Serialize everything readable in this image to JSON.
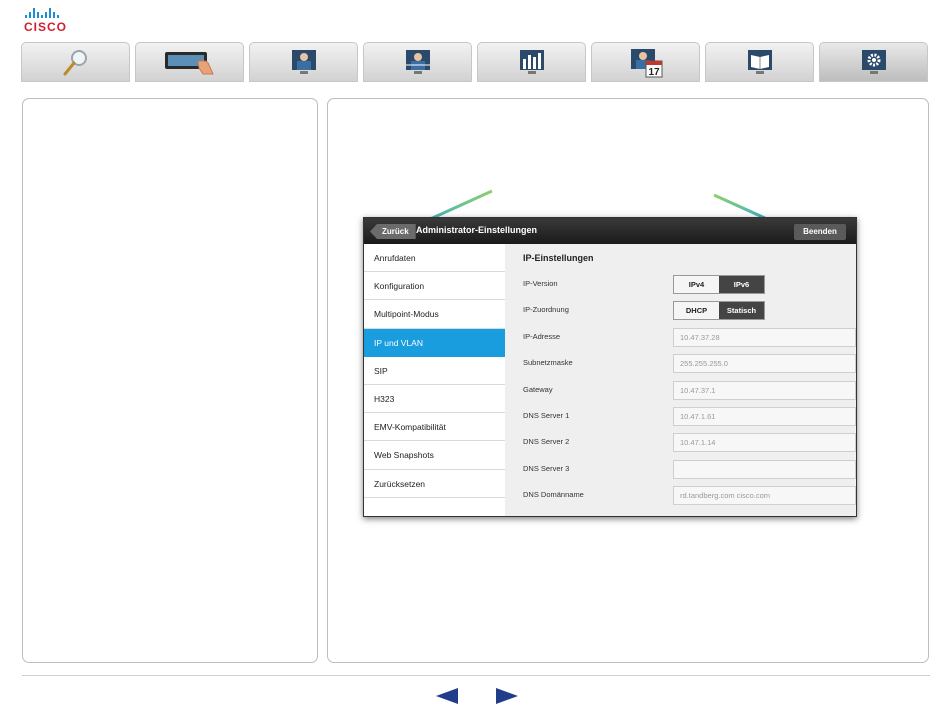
{
  "brand": {
    "name": "CISCO",
    "logo_color": "#d0202f",
    "bars_color": "#1b8fd1"
  },
  "tabs": [
    {
      "icon": "magnifier-icon"
    },
    {
      "icon": "touch-panel-icon"
    },
    {
      "icon": "presenter-icon"
    },
    {
      "icon": "network-presenter-icon"
    },
    {
      "icon": "statistics-presenter-icon"
    },
    {
      "icon": "calendar-presenter-icon",
      "calendar_day": "17"
    },
    {
      "icon": "book-presenter-icon"
    },
    {
      "icon": "settings-presenter-icon",
      "active": true
    }
  ],
  "screenshot": {
    "back_label": "Zurück",
    "title": "Administrator-Einstellungen",
    "end_label": "Beenden",
    "menu": [
      {
        "label": "Anrufdaten",
        "active": false
      },
      {
        "label": "Konfiguration",
        "active": false
      },
      {
        "label": "Multipoint-Modus",
        "active": false
      },
      {
        "label": "IP und VLAN",
        "active": true
      },
      {
        "label": "SIP",
        "active": false
      },
      {
        "label": "H323",
        "active": false
      },
      {
        "label": "EMV-Kompatibilität",
        "active": false
      },
      {
        "label": "Web Snapshots",
        "active": false
      },
      {
        "label": "Zurücksetzen",
        "active": false
      }
    ],
    "content": {
      "title": "IP-Einstellungen",
      "rows": [
        {
          "label": "IP-Version",
          "toggle": [
            "IPv4",
            "IPv6"
          ]
        },
        {
          "label": "IP-Zuordnung",
          "toggle": [
            "DHCP",
            "Statisch"
          ]
        },
        {
          "label": "IP-Adresse",
          "value": "10.47.37.28"
        },
        {
          "label": "Subnetzmaske",
          "value": "255.255.255.0"
        },
        {
          "label": "Gateway",
          "value": "10.47.37.1"
        },
        {
          "label": "DNS Server 1",
          "value": "10.47.1.61"
        },
        {
          "label": "DNS Server 2",
          "value": "10.47.1.14"
        },
        {
          "label": "DNS Server 3",
          "value": ""
        },
        {
          "label": "DNS Domänname",
          "value": "rd.tandberg.com cisco.com"
        }
      ]
    },
    "active_color": "#1a9ddf"
  },
  "navigation": {
    "prev_icon": "triangle-left-icon",
    "next_icon": "triangle-right-icon",
    "arrow_color": "#1f3d88"
  }
}
